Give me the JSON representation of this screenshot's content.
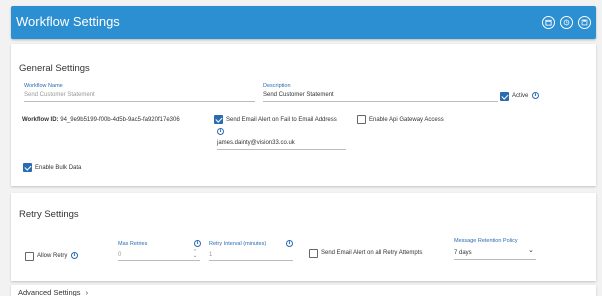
{
  "header": {
    "title": "Workflow Settings"
  },
  "general": {
    "title": "General Settings",
    "workflow_name_label": "Workflow Name",
    "workflow_name_placeholder": "Send Customer Statement",
    "description_label": "Description",
    "description_value": "Send Customer Statement",
    "active_label": "Active",
    "active_checked": true,
    "workflow_id_label": "Workflow ID:",
    "workflow_id_value": "94_9e9b5199-f00b-4d5b-9ac5-fa920f17e306",
    "send_email_fail_label": "Send Email Alert on Fail to Email Address",
    "send_email_fail_checked": true,
    "email_value": "james.dainty@vision33.co.uk",
    "api_gateway_label": "Enable Api Gateway Access",
    "api_gateway_checked": false,
    "bulk_data_label": "Enable Bulk Data",
    "bulk_data_checked": true
  },
  "retry": {
    "title": "Retry Settings",
    "allow_retry_label": "Allow Retry",
    "allow_retry_checked": false,
    "max_retries_label": "Max Retries",
    "max_retries_value": "0",
    "retry_interval_label": "Retry Interval (minutes)",
    "retry_interval_value": "1",
    "send_email_retry_label": "Send Email Alert on all Retry Attempts",
    "send_email_retry_checked": false,
    "retention_label": "Message Retention Policy",
    "retention_value": "7 days"
  },
  "advanced": {
    "title": "Advanced Settings"
  }
}
